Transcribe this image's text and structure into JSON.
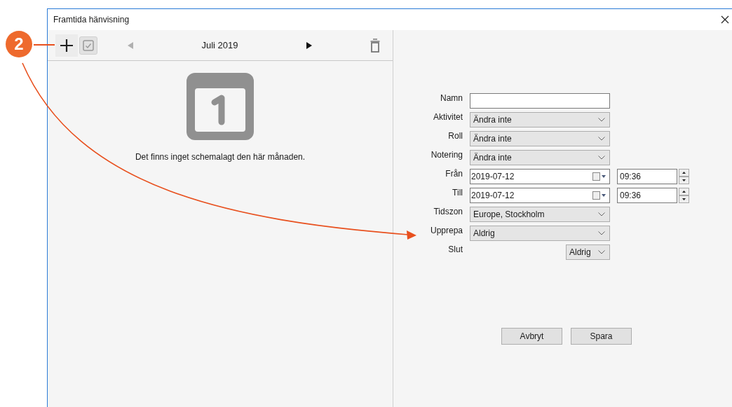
{
  "window": {
    "title": "Framtida hänvisning"
  },
  "callout": {
    "number": "2"
  },
  "toolbar": {
    "month": "Juli 2019",
    "previous": {
      "disabled": true
    },
    "next": {
      "disabled": false
    }
  },
  "empty_state": {
    "message": "Det finns inget schemalagt den här månaden."
  },
  "form": {
    "fields": [
      {
        "kind": "text",
        "label": "Namn"
      },
      {
        "kind": "select",
        "label": "Aktivitet",
        "value": "Ändra inte"
      },
      {
        "kind": "select",
        "label": "Roll",
        "value": "Ändra inte"
      },
      {
        "kind": "select",
        "label": "Notering",
        "value": "Ändra inte"
      },
      {
        "kind": "datetime",
        "label": "Från",
        "value": "2019-07-12",
        "time": "09:36"
      },
      {
        "kind": "datetime",
        "label": "Till",
        "value": "2019-07-12",
        "time": "09:36"
      },
      {
        "kind": "select",
        "label": "Tidszon",
        "value": "Europe, Stockholm"
      },
      {
        "kind": "select",
        "label": "Upprepa",
        "value": "Aldrig"
      },
      {
        "kind": "small_select",
        "label": "Slut",
        "value": "Aldrig"
      }
    ]
  },
  "buttons": [
    "Avbryt",
    "Spara"
  ]
}
